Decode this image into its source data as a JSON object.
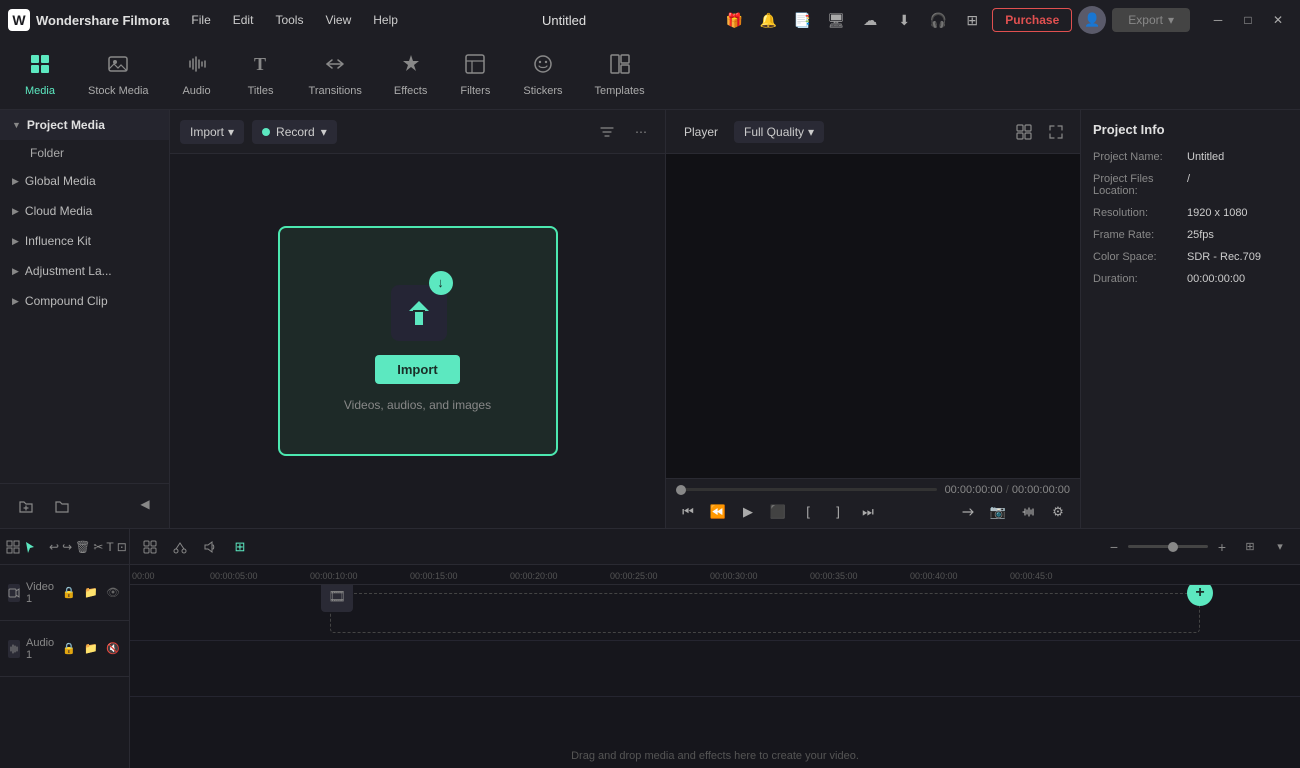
{
  "app": {
    "name": "Wondershare Filmora",
    "title": "Untitled",
    "logo": "W"
  },
  "menu": {
    "items": [
      "File",
      "Edit",
      "Tools",
      "View",
      "Help"
    ]
  },
  "toolbar": {
    "tools": [
      {
        "id": "media",
        "label": "Media",
        "icon": "▦",
        "active": true
      },
      {
        "id": "stock-media",
        "label": "Stock Media",
        "icon": "🖼",
        "active": false
      },
      {
        "id": "audio",
        "label": "Audio",
        "icon": "♪",
        "active": false
      },
      {
        "id": "titles",
        "label": "Titles",
        "icon": "T",
        "active": false
      },
      {
        "id": "transitions",
        "label": "Transitions",
        "icon": "⇄",
        "active": false
      },
      {
        "id": "effects",
        "label": "Effects",
        "icon": "✦",
        "active": false
      },
      {
        "id": "filters",
        "label": "Filters",
        "icon": "◫",
        "active": false
      },
      {
        "id": "stickers",
        "label": "Stickers",
        "icon": "⊙",
        "active": false
      },
      {
        "id": "templates",
        "label": "Templates",
        "icon": "⊞",
        "active": false
      }
    ],
    "export_label": "Export",
    "purchase_label": "Purchase"
  },
  "sidebar": {
    "sections": [
      {
        "id": "project-media",
        "label": "Project Media",
        "active": true,
        "has_folder": true,
        "folder_label": "Folder"
      },
      {
        "id": "global-media",
        "label": "Global Media",
        "active": false
      },
      {
        "id": "cloud-media",
        "label": "Cloud Media",
        "active": false
      },
      {
        "id": "influence-kit",
        "label": "Influence Kit",
        "active": false
      },
      {
        "id": "adjustment-la",
        "label": "Adjustment La...",
        "active": false
      },
      {
        "id": "compound-clip",
        "label": "Compound Clip",
        "active": false
      }
    ],
    "bottom_icons": [
      "folder-add",
      "folder"
    ]
  },
  "media_panel": {
    "import_label": "Import",
    "record_label": "Record",
    "drop_zone": {
      "import_btn_label": "Import",
      "description": "Videos, audios, and images"
    }
  },
  "preview": {
    "tab_label": "Player",
    "quality_label": "Full Quality",
    "time_current": "00:00:00:00",
    "time_total": "00:00:00:00",
    "playback_controls": [
      "⏮",
      "⏪",
      "▶",
      "⬛",
      "[",
      "]",
      "⏭",
      "◇",
      "⊡",
      "⊕",
      "◎",
      "⊖"
    ],
    "extra_icons": [
      "⊟",
      "◨",
      "⊠"
    ]
  },
  "project_info": {
    "title": "Project Info",
    "fields": [
      {
        "label": "Project Name:",
        "value": "Untitled"
      },
      {
        "label": "Project Files Location:",
        "value": "/"
      },
      {
        "label": "Resolution:",
        "value": "1920 x 1080"
      },
      {
        "label": "Frame Rate:",
        "value": "25fps"
      },
      {
        "label": "Color Space:",
        "value": "SDR - Rec.709"
      },
      {
        "label": "Duration:",
        "value": "00:00:00:00"
      }
    ]
  },
  "timeline": {
    "tracks": [
      {
        "label": "Video 1",
        "type": "video"
      },
      {
        "label": "Audio 1",
        "type": "audio"
      }
    ],
    "ruler_marks": [
      "00:00",
      "00:00:05:00",
      "00:00:10:00",
      "00:00:15:00",
      "00:00:20:00",
      "00:00:25:00",
      "00:00:30:00",
      "00:00:35:00",
      "00:00:40:00",
      "00:00:45:0"
    ],
    "drag_drop_text": "Drag and drop media and effects here to create your video.",
    "tools": [
      "grid",
      "select",
      "divider",
      "undo",
      "redo",
      "delete",
      "cut",
      "text",
      "crop",
      "rotate",
      "ai",
      "link",
      "snap",
      "speed",
      "mask",
      "audio",
      "clip",
      "multi",
      "multi2"
    ],
    "zoom_minus": "−",
    "zoom_plus": "+"
  }
}
